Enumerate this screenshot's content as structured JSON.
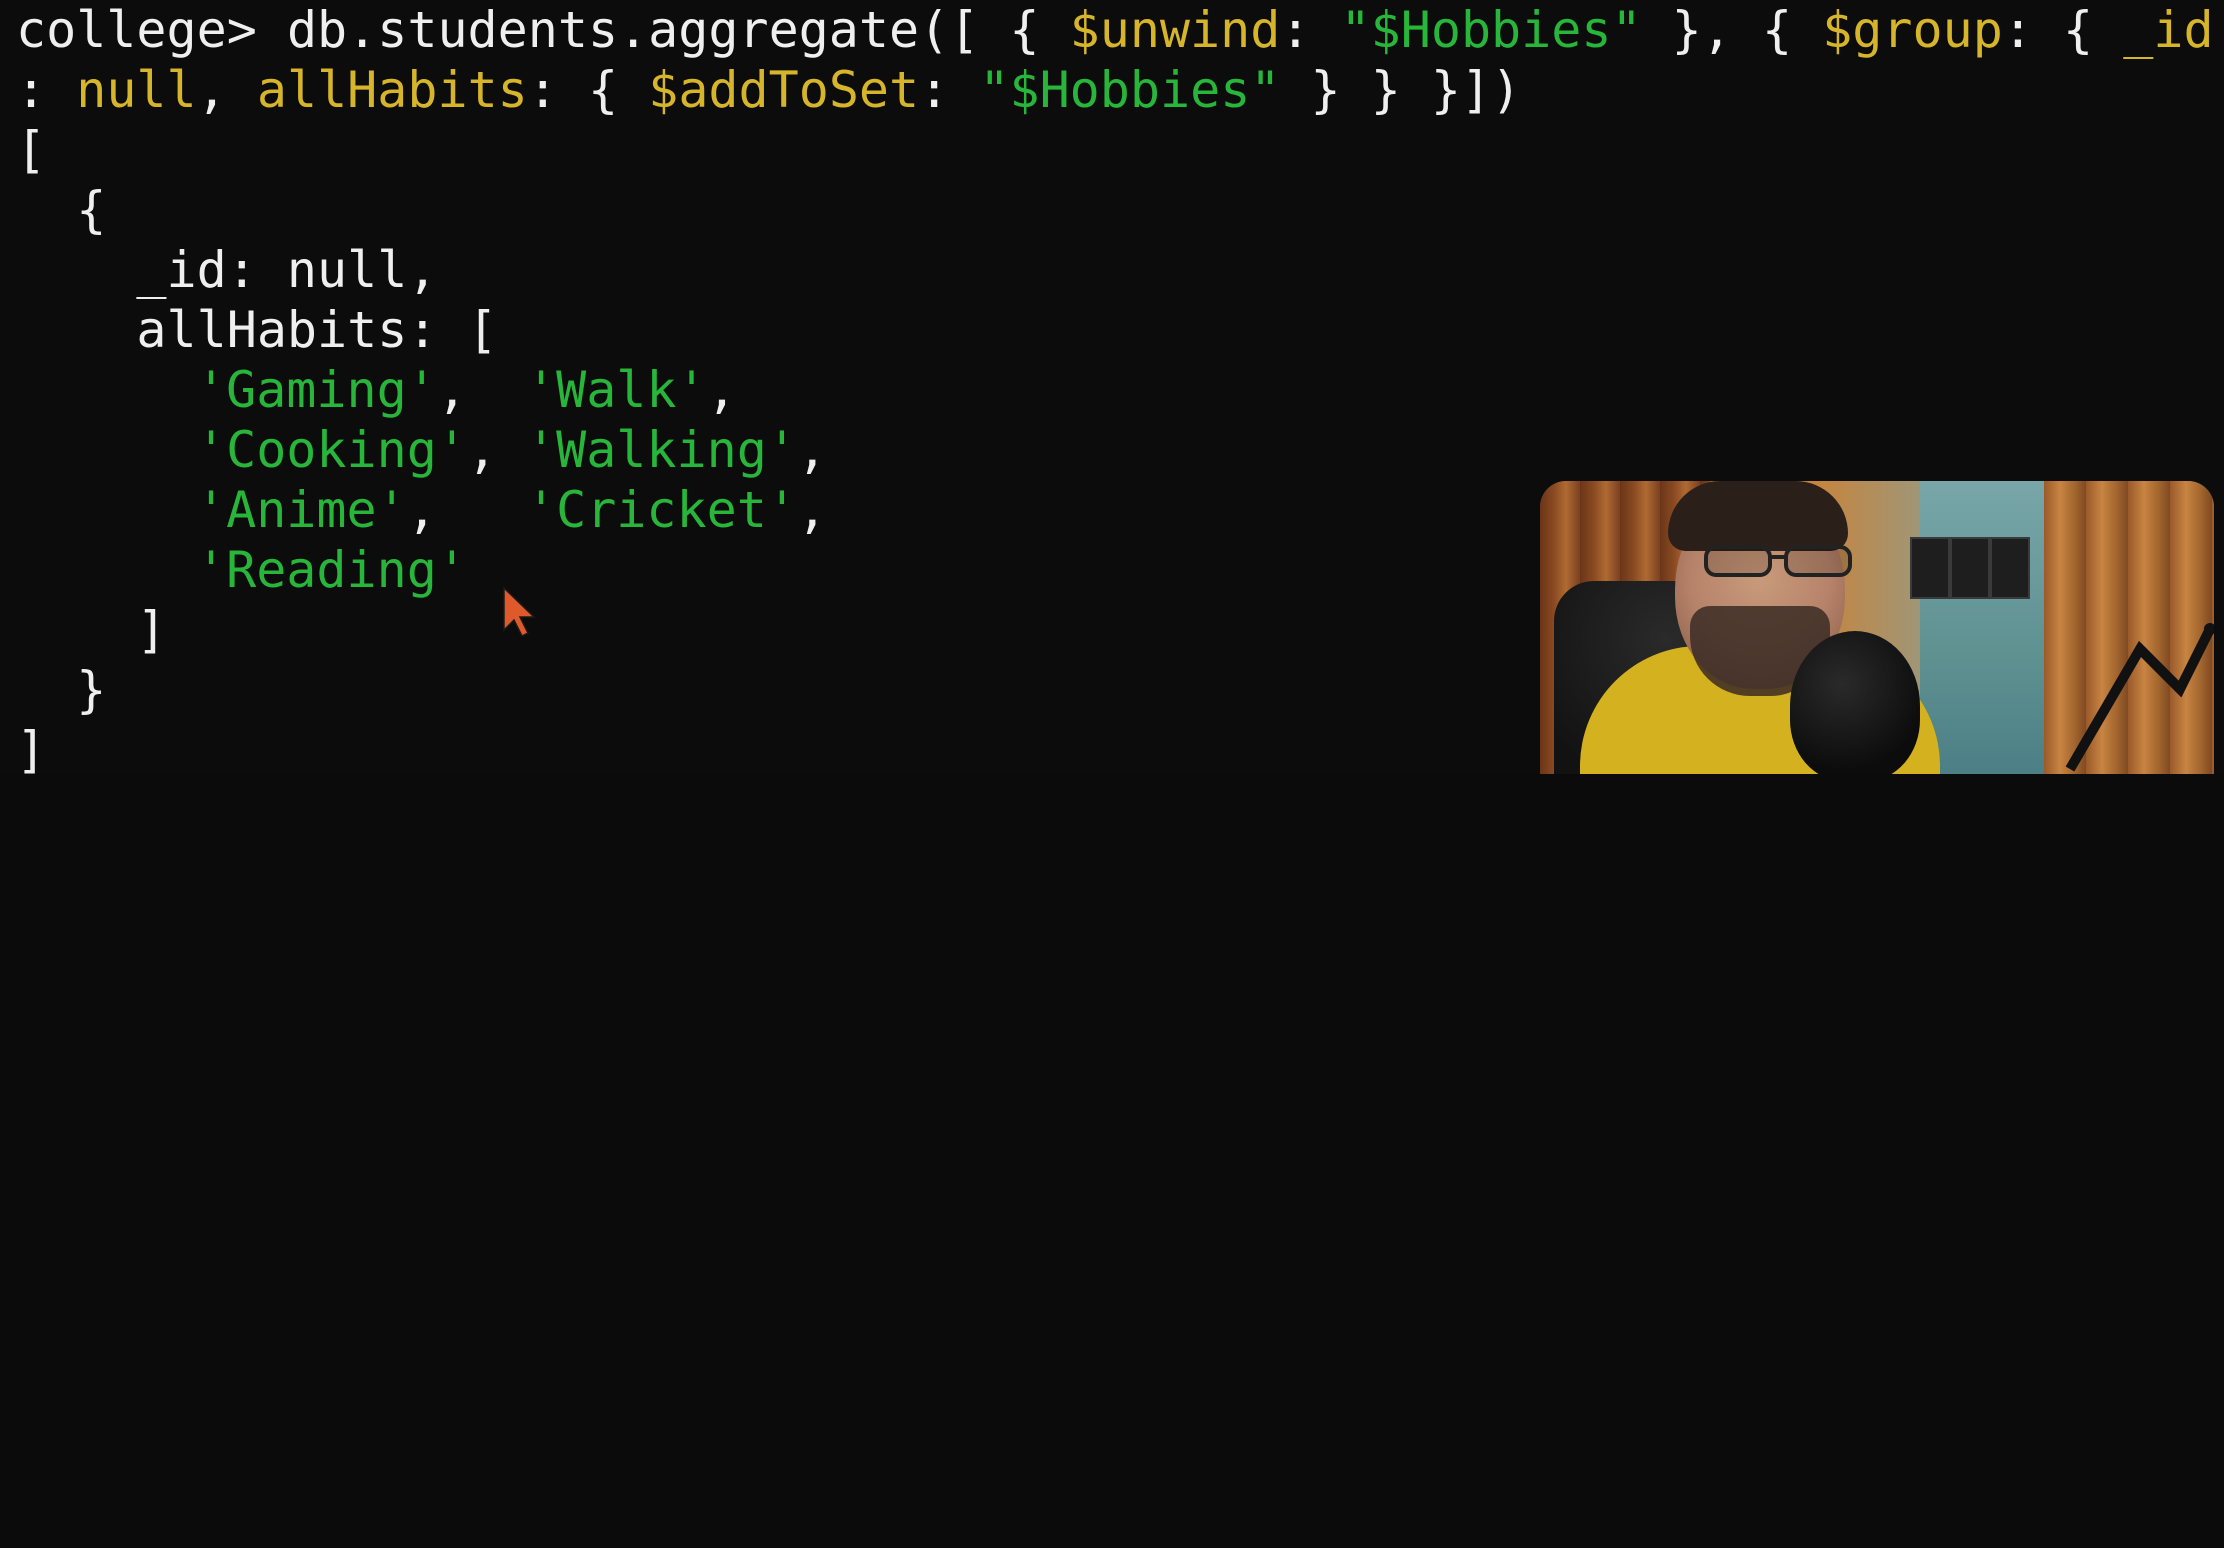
{
  "terminal": {
    "line1": {
      "prompt": "college> ",
      "cmd_pre": "db.students.aggregate([ { ",
      "k1": "$unwind",
      "sep1": ": ",
      "v1": "\"$Hobbies\"",
      "mid": " }, { ",
      "k2": "$group",
      "sep2": ": { ",
      "k3": "_id"
    },
    "line2": {
      "pre": ": ",
      "nullval": "null",
      "comma": ", ",
      "k4": "allHabits",
      "sep": ": { ",
      "k5": "$addToSet",
      "sep2": ": ",
      "v2": "\"$Hobbies\"",
      "end": " } } }])"
    },
    "line3": "[",
    "line4": "  {",
    "line5": {
      "key": "    _id",
      "rest": ": null,"
    },
    "line6": {
      "key": "    allHabits",
      "rest": ": ["
    },
    "array_items": [
      [
        "'Gaming'",
        "'Walk'"
      ],
      [
        "'Cooking'",
        "'Walking'"
      ],
      [
        "'Anime'",
        "'Cricket'"
      ],
      [
        "'Reading'"
      ]
    ],
    "line11": "    ]",
    "line12": "  }",
    "line13": "]"
  },
  "webcam": {
    "label": "presenter-webcam"
  }
}
